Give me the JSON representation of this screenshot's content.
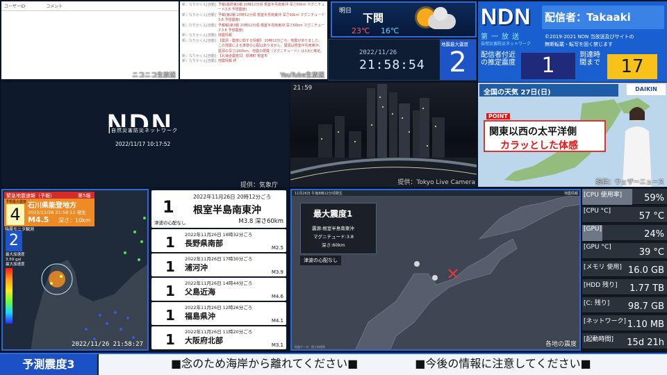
{
  "comments_panel": {
    "header_user": "ユーザーID",
    "header_comment": "コメント",
    "source_label": "ニコニコ生放送"
  },
  "youtube_chat": {
    "source_label": "YouTube生放送",
    "rows": [
      {
        "user": "新：なりかくん[自動]",
        "text": "予報(最終第1報 20時12分頃 根室半島南東沖 深さ60km マグニチュード3.8 予想震度)"
      },
      {
        "user": "新：なりかくん[自動]",
        "text": "予報(第2報 20時12分頃 根室半島南東沖 深さ60km マグニチュード3.8 予想震度)"
      },
      {
        "user": "新：なりかくん[自動]",
        "text": "予報報(第3報 20時12分頃 根室半島南東沖 深さ60km マグニチュード3.8 予想震度)"
      },
      {
        "user": "新：なりかくん[自動]",
        "text": "地震情報"
      },
      {
        "user": "新：なりかくん[自動]",
        "text": "【震源・震度に関する情報】 20時12分ごろ、地震がありました。この地震による津波の心配はありません。震源は根室半島南東沖、震源の深さは60km、地震の規模（マグニチュード）は3.8と推定。"
      },
      {
        "user": "新：なりかくん[自動]",
        "text": "【北海道震度1】 標津町 根室市"
      },
      {
        "user": "新：なりかくん[自動]",
        "text": "地震情報 終"
      }
    ]
  },
  "weather": {
    "day": "明日",
    "city": "下関",
    "high": "23℃",
    "low": "16℃",
    "icon": "sun-cloud-icon"
  },
  "clock": {
    "date": "2022/11/26",
    "time": "21:58:54",
    "intensity_label": "地震最大震度",
    "intensity": "2"
  },
  "brand": {
    "logo": "NDN",
    "caster": "配信者：Takaaki",
    "sub1": "第一放送",
    "sub2": "自然災害防災ネットワーク",
    "copyright_line1": "©2019-2021 NDN 当放送及びサイトの",
    "copyright_line2": "無断転載・転写を固く禁じます",
    "est_label": "配信者付近の推定震度",
    "est_value": "1",
    "arrival_label": "到達時間まで",
    "arrival_value": "17"
  },
  "ndn_video": {
    "logo": "NDN",
    "sub": "自然災害防災ネットワーク",
    "date": "2022/11/17 10:17:52"
  },
  "night_cam": {
    "timestamp": "21:59",
    "credit": "提供：Tokyo Live Camera",
    "left_credit": "提供：気象庁"
  },
  "wx_news": {
    "header": "全国の天気 27日(日)",
    "sponsor": "DAIKIN",
    "point": "POINT",
    "caption1": "関東以西の太平洋側",
    "caption2": "カラッとした体感",
    "credit": "提供：ウェザーニュース"
  },
  "seis_map": {
    "alert_header": "緊急地震速報（予報）",
    "report_no": "第5報",
    "predicted_label": "予想最大震度",
    "predicted": "4",
    "area": "石川県能登地方",
    "alert_time": "2022/11/26 21:58:12 発生",
    "magnitude": "M4.5",
    "depth": "深さ：10km",
    "observed_label": "強震モニタ観測",
    "observed": "2",
    "accel_label": "最大加速度",
    "accel_value": "3.59 gal",
    "accel_label2": "最大加速度",
    "map_time": "2022/11/26 21:58:27"
  },
  "eq_list": [
    {
      "num": "1",
      "dt": "2022年11月26日 20時12分ごろ",
      "loc": "根室半島南東沖",
      "mag": "M3.8 深さ60km",
      "tsunami": "津波の心配なし"
    },
    {
      "num": "1",
      "dt": "2022年11月26日 18時32分ごろ",
      "loc": "長野県南部",
      "mag": "M2.5"
    },
    {
      "num": "1",
      "dt": "2022年11月26日 17時30分ごろ",
      "loc": "浦河沖",
      "mag": "M3.9"
    },
    {
      "num": "1",
      "dt": "2022年11月26日 14時44分ごろ",
      "loc": "父島近海",
      "mag": "M4.6"
    },
    {
      "num": "1",
      "dt": "2022年11月26日 12時26分ごろ",
      "loc": "福島県沖",
      "mag": "M4.1"
    },
    {
      "num": "1",
      "dt": "2022年11月26日 11時20分ごろ",
      "loc": "大阪府北部",
      "mag": "M3.1"
    }
  ],
  "japan_map": {
    "header": "11月26日 午後8時12分頃発生",
    "header_right": "地震情報",
    "card_title": "最大震度1",
    "card_l1": "震源:根室半島南東沖",
    "card_l2": "マグニチュード:3.8",
    "card_l3": "深さ:60km",
    "tsunami": "津波の心配なし",
    "credit": "各地の震度",
    "foot": "地図データ：国土地理院"
  },
  "stats": [
    {
      "label": "[CPU 使用率]",
      "value": "59%",
      "fill": 0.59
    },
    {
      "label": "[CPU °C]",
      "value": "57 °C",
      "fill": 0.0
    },
    {
      "label": "[GPU]",
      "value": "24%",
      "fill": 0.24
    },
    {
      "label": "[GPU °C]",
      "value": "39 °C",
      "fill": 0.0
    },
    {
      "label": "[メモリ 使用]",
      "value": "16.0 GB",
      "fill": 0.0
    },
    {
      "label": "[HDD 残り]",
      "value": "1.77 TB",
      "fill": 0.0
    },
    {
      "label": "[C: 残り]",
      "value": "98.7 GB",
      "fill": 0.0
    },
    {
      "label": "[ネットワーク]",
      "value": "1.10 MB",
      "fill": 0.0
    },
    {
      "label": "[起動時間]",
      "value": "15d 21h",
      "fill": 0.0
    }
  ],
  "ticker": {
    "predicted": "予測震度3",
    "msg1": "■念のため海岸から離れてください■",
    "msg2": "■今後の情報に注意してください■"
  }
}
